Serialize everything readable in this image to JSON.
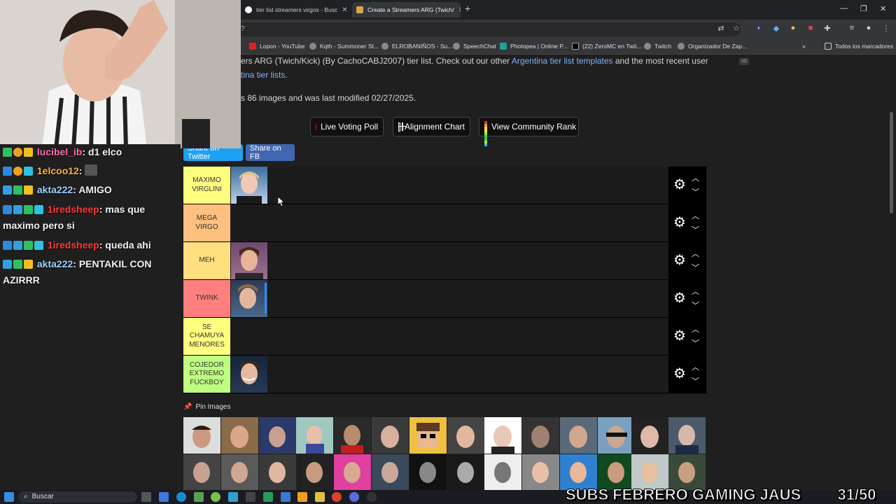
{
  "browser": {
    "tabs": [
      {
        "label": "tier list streamers virgos - Busc",
        "active": false
      },
      {
        "label": "Create a Streamers ARG (Twich/",
        "active": true
      }
    ],
    "omnibox": "?",
    "bookmarks": [
      "Lopon - YouTube",
      "Kqth - Summoner St...",
      "ELROBANIÑOS - Su...",
      "SpeechChat",
      "Photopea | Online P...",
      "(22) ZeroMC en Twit...",
      "Twitch",
      "Organizador De Zap..."
    ],
    "all_bookmarks": "Todos los marcadores"
  },
  "page": {
    "desc1_pre": "ers ARG (Twich/Kick) (By CachoCABJ2007) tier list. Check out our other ",
    "desc1_link": "Argentina tier list templates",
    "desc1_post": " and the most recent user",
    "desc2_link": "tina tier lists",
    "desc2_post": ".",
    "desc3": "s 86 images and was last modified 02/27/2025.",
    "ad": "AD",
    "buttons": {
      "live_poll": "Live Voting Poll",
      "alignment": "Alignment Chart",
      "community": "View Community Rank",
      "share_twitter": "Share on Twitter",
      "share_fb": "Share on FB"
    },
    "tiers": [
      {
        "label": "MAXIMO VIRGLINI",
        "color": "#ffff7f",
        "faces": 1
      },
      {
        "label": "MEGA VIRGO",
        "color": "#ffbf7f",
        "faces": 0
      },
      {
        "label": "MEH",
        "color": "#ffdf7f",
        "faces": 1
      },
      {
        "label": "TWINK",
        "color": "#ff7f7f",
        "faces": 1
      },
      {
        "label": "SE CHAMUYA MENORES",
        "color": "#ffff7f",
        "faces": 0
      },
      {
        "label": "COJEDOR EXTREMO FUCKBOY",
        "color": "#bfff7f",
        "faces": 1
      }
    ],
    "pin_images": "Pin Images"
  },
  "chat": [
    {
      "user": "lucibel_ib",
      "color": "#ff6fae",
      "text": ": d1 elco"
    },
    {
      "user": "1elcoo12",
      "color": "#ffb23f",
      "text": ": "
    },
    {
      "user": "akta222",
      "color": "#9fd0ff",
      "text": ": AMIGO"
    },
    {
      "user": "1iredsheep",
      "color": "#ff3b3b",
      "text": ": mas que maximo pero si"
    },
    {
      "user": "1iredsheep",
      "color": "#ff3b3b",
      "text": ": queda ahi"
    },
    {
      "user": "akta222",
      "color": "#9fd0ff",
      "text": ": PENTAKIL CON AZIRRR"
    }
  ],
  "taskbar": {
    "search": "Buscar",
    "banner": "SUBS FEBRERO GAMING JAUS",
    "counter": "31/50"
  }
}
